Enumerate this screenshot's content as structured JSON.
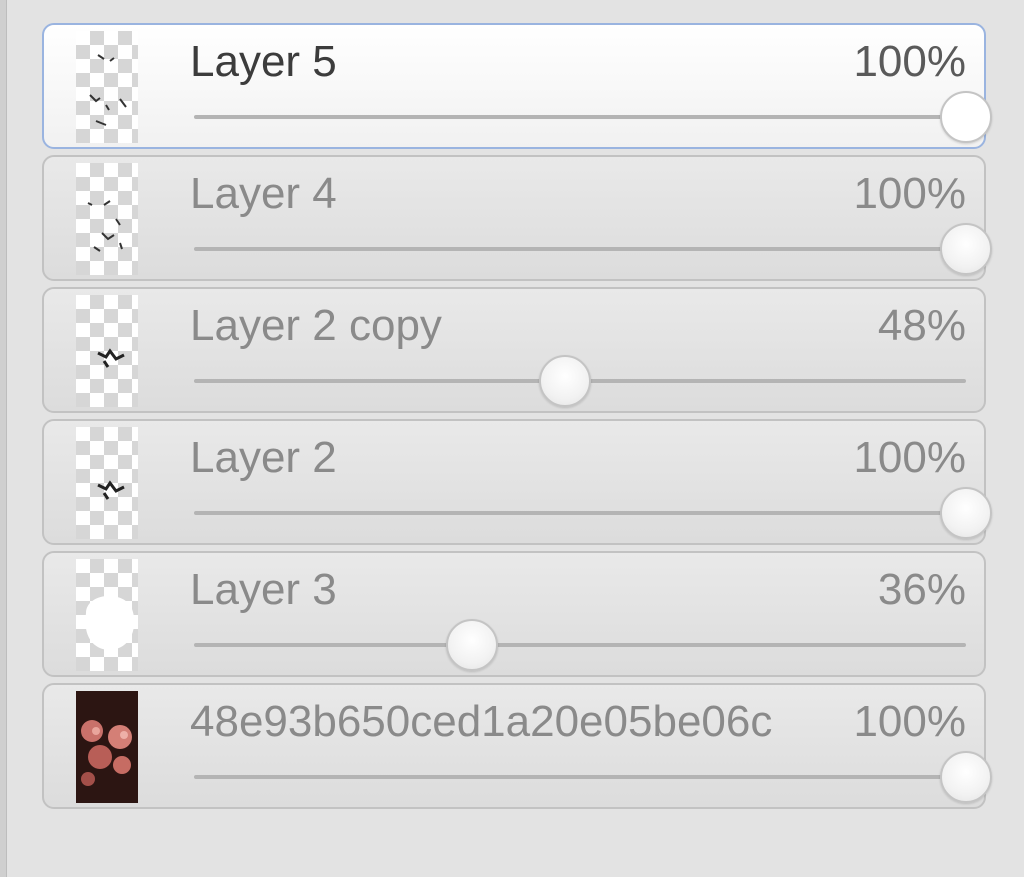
{
  "layers_panel": {
    "layers": [
      {
        "name": "Layer 5",
        "opacity_label": "100%",
        "opacity": 1.0,
        "active": true,
        "thumb": "sparse-strokes"
      },
      {
        "name": "Layer 4",
        "opacity_label": "100%",
        "opacity": 1.0,
        "active": false,
        "thumb": "sparse-strokes"
      },
      {
        "name": "Layer 2 copy",
        "opacity_label": "48%",
        "opacity": 0.48,
        "active": false,
        "thumb": "small-mark"
      },
      {
        "name": "Layer 2",
        "opacity_label": "100%",
        "opacity": 1.0,
        "active": false,
        "thumb": "small-mark"
      },
      {
        "name": "Layer 3",
        "opacity_label": "36%",
        "opacity": 0.36,
        "active": false,
        "thumb": "white-blob"
      },
      {
        "name": "48e93b650ced1a20e05be06c",
        "opacity_label": "100%",
        "opacity": 1.0,
        "active": false,
        "thumb": "photo"
      }
    ],
    "colors": {
      "active_border": "#9ab4e0",
      "item_border": "#c2c2c2",
      "panel_background": "#e3e3e3"
    }
  }
}
